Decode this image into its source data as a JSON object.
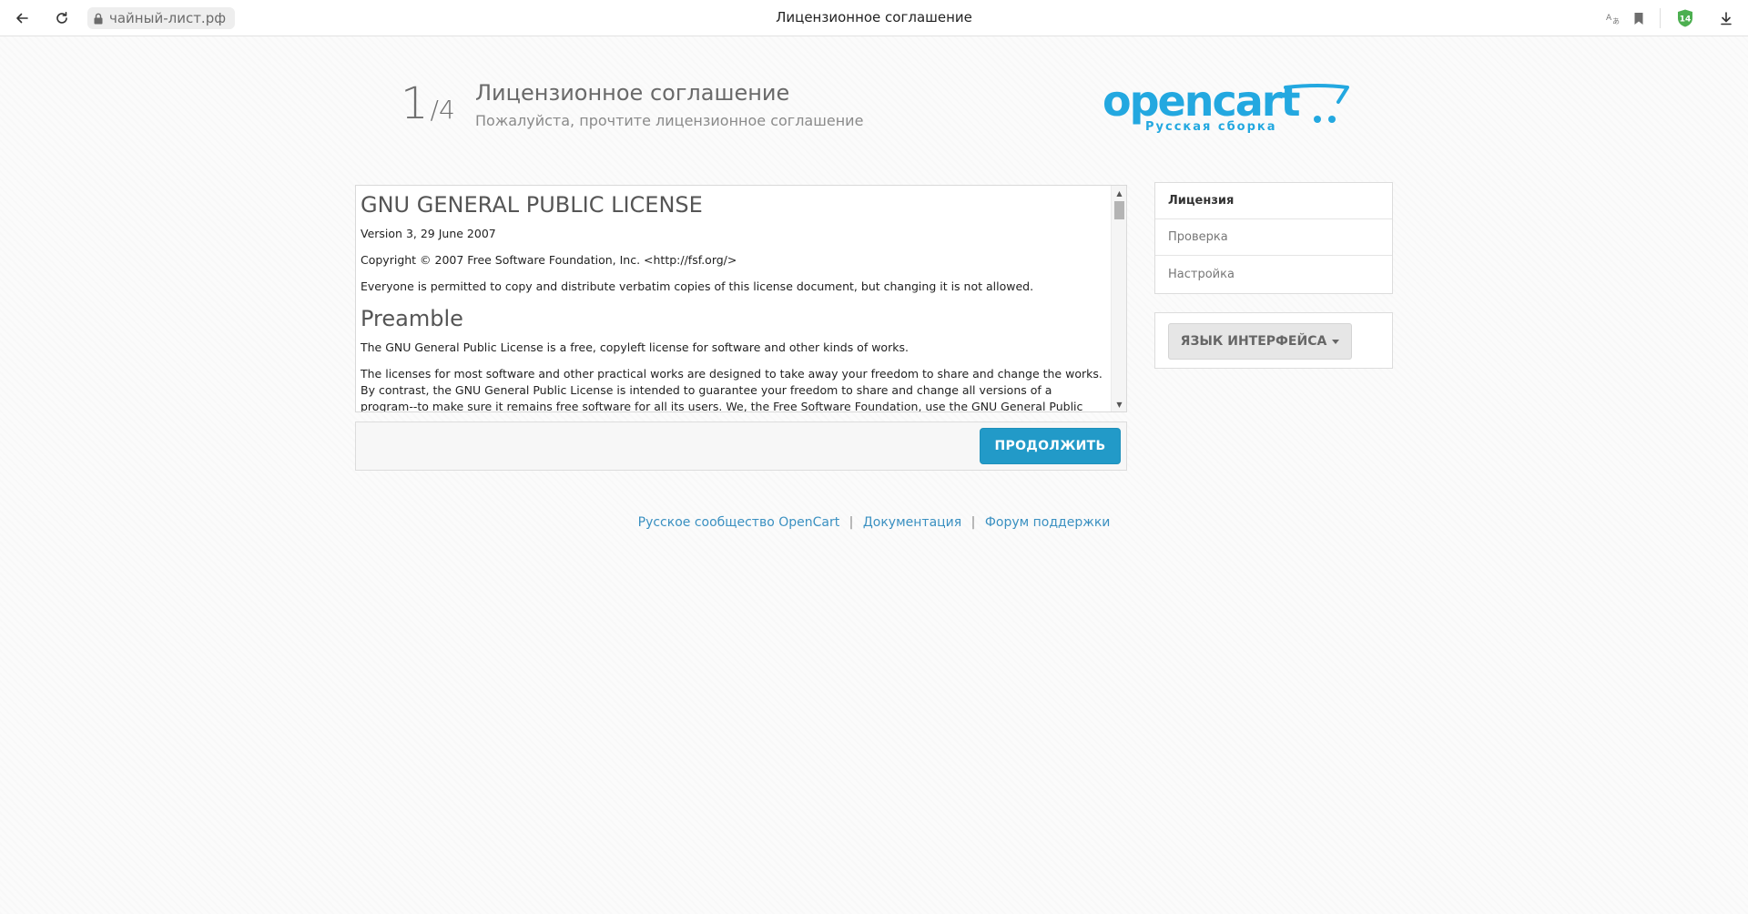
{
  "browser": {
    "url": "чайный-лист.рф",
    "tab_title": "Лицензионное соглашение",
    "badge_count": "14"
  },
  "header": {
    "step_current": "1",
    "step_total": "/4",
    "title": "Лицензионное соглашение",
    "subtitle": "Пожалуйста, прочтите лицензионное соглашение"
  },
  "logo": {
    "text": "opencart",
    "tagline": "Русская сборка",
    "color": "#23a8e0"
  },
  "license": {
    "heading": "GNU GENERAL PUBLIC LICENSE",
    "version": "Version 3, 29 June 2007",
    "copyright": "Copyright © 2007 Free Software Foundation, Inc. <http://fsf.org/>",
    "permission": "Everyone is permitted to copy and distribute verbatim copies of this license document, but changing it is not allowed.",
    "preamble_heading": "Preamble",
    "preamble_p1": "The GNU General Public License is a free, copyleft license for software and other kinds of works.",
    "preamble_p2": "The licenses for most software and other practical works are designed to take away your freedom to share and change the works. By contrast, the GNU General Public License is intended to guarantee your freedom to share and change all versions of a program--to make sure it remains free software for all its users. We, the Free Software Foundation, use the GNU General Public License for most of"
  },
  "actions": {
    "continue_label": "ПРОДОЛЖИТЬ",
    "primary_color": "#229ac8"
  },
  "sidebar": {
    "steps": [
      {
        "label": "Лицензия",
        "active": true
      },
      {
        "label": "Проверка",
        "active": false
      },
      {
        "label": "Настройка",
        "active": false
      }
    ],
    "language_button": "ЯЗЫК ИНТЕРФЕЙСА"
  },
  "footer": {
    "links": [
      "Русское сообщество OpenCart",
      "Документация",
      "Форум поддержки"
    ],
    "separator": "|"
  }
}
